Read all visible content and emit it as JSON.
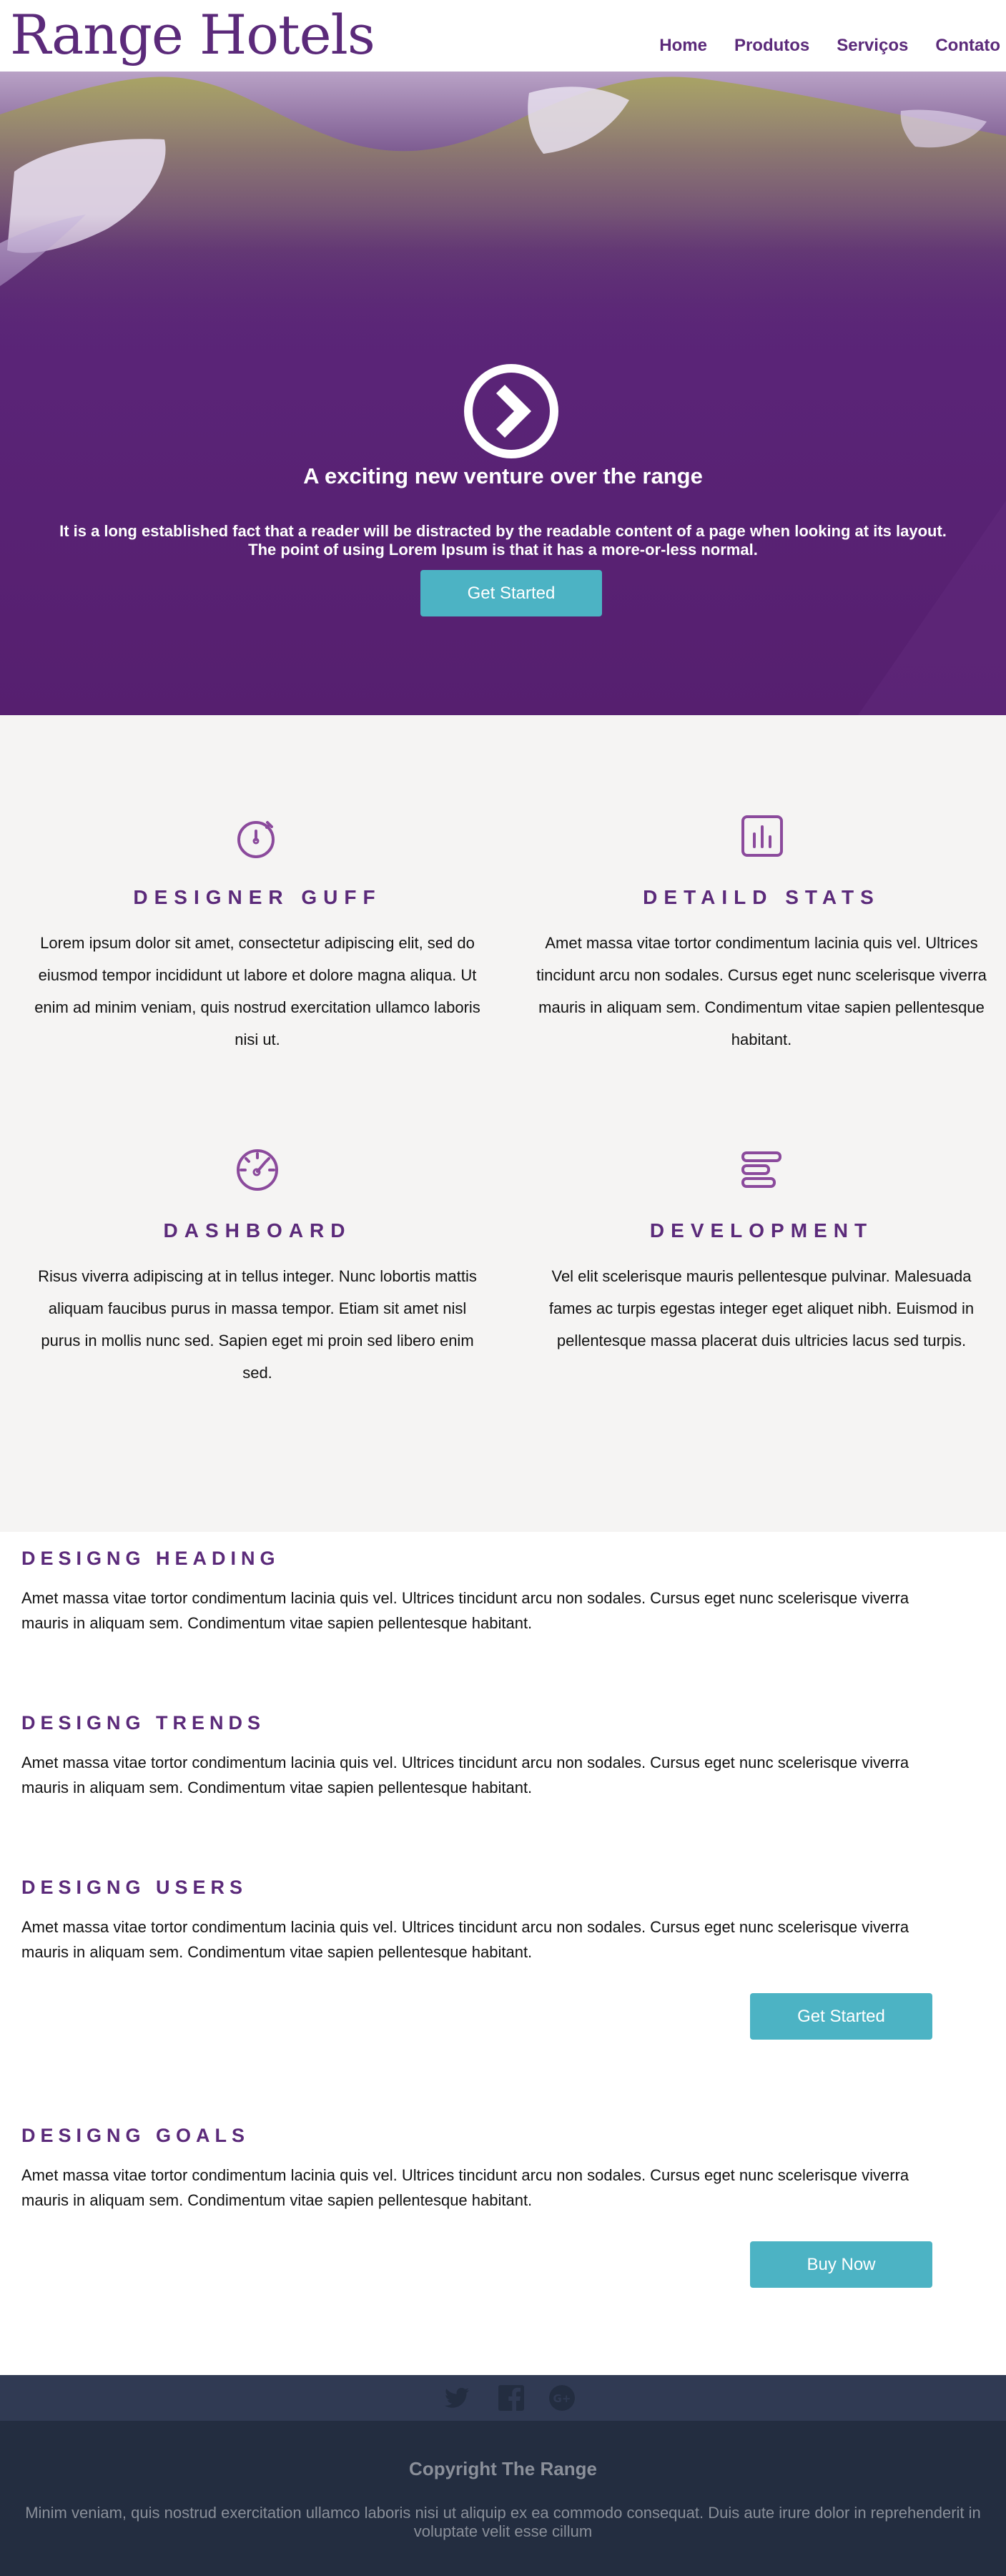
{
  "header": {
    "logo": "Range Hotels",
    "nav": [
      "Home",
      "Produtos",
      "Serviços",
      "Contato"
    ]
  },
  "hero": {
    "title": "A exciting new venture over the range",
    "body_line1": "It is a long established fact that a reader will be distracted by the readable content of a page when looking at its layout.",
    "body_line2": "The point of using Lorem Ipsum is that it has a more-or-less normal.",
    "button": "Get Started",
    "icon": "chevron-right-circle-icon"
  },
  "features": [
    {
      "icon": "stopwatch-icon",
      "title": "DESIGNER GUFF",
      "lines": [
        "Lorem ipsum dolor sit amet, consectetur adipiscing elit, sed do",
        "eiusmod tempor incididunt ut labore et dolore magna aliqua. Ut",
        "enim ad minim veniam, quis nostrud exercitation ullamco laboris",
        "nisi ut."
      ]
    },
    {
      "icon": "bar-chart-icon",
      "title": "DETAILD STATS",
      "lines": [
        "Amet massa vitae tortor condimentum lacinia quis vel. Ultrices",
        "tincidunt arcu non sodales. Cursus eget nunc scelerisque viverra",
        "mauris in aliquam sem. Condimentum vitae sapien pellentesque",
        "habitant."
      ]
    },
    {
      "icon": "speedometer-icon",
      "title": "DASHBOARD",
      "lines": [
        "Risus viverra adipiscing at in tellus integer. Nunc lobortis mattis",
        "aliquam faucibus purus in massa tempor. Etiam sit amet nisl",
        "purus in mollis nunc sed. Sapien eget mi proin sed libero enim",
        "sed."
      ]
    },
    {
      "icon": "menu-bars-icon",
      "title": "DEVELOPMENT",
      "lines": [
        "Vel elit scelerisque mauris pellentesque pulvinar. Malesuada",
        "fames ac turpis egestas integer eget aliquet nibh. Euismod in",
        "pellentesque massa placerat duis ultricies lacus sed turpis."
      ]
    }
  ],
  "blocks": [
    {
      "title": "DESIGNG HEADING",
      "line1": "Amet massa vitae tortor condimentum lacinia quis vel. Ultrices tincidunt arcu non sodales. Cursus eget nunc scelerisque viverra",
      "line2": "mauris in aliquam sem. Condimentum vitae sapien pellentesque habitant."
    },
    {
      "title": "DESIGNG TRENDS",
      "line1": "Amet massa vitae tortor condimentum lacinia quis vel. Ultrices tincidunt arcu non sodales. Cursus eget nunc scelerisque viverra",
      "line2": "mauris in aliquam sem. Condimentum vitae sapien pellentesque habitant."
    },
    {
      "title": "DESIGNG USERS",
      "line1": "Amet massa vitae tortor condimentum lacinia quis vel. Ultrices tincidunt arcu non sodales. Cursus eget nunc scelerisque viverra",
      "line2": "mauris in aliquam sem. Condimentum vitae sapien pellentesque habitant.",
      "button": "Get Started"
    },
    {
      "title": "DESIGNG GOALS",
      "line1": "Amet massa vitae tortor condimentum lacinia quis vel. Ultrices tincidunt arcu non sodales. Cursus eget nunc scelerisque viverra",
      "line2": "mauris in aliquam sem. Condimentum vitae sapien pellentesque habitant.",
      "button": "Buy Now"
    }
  ],
  "social": [
    "twitter-icon",
    "facebook-icon",
    "google-plus-icon"
  ],
  "footer": {
    "copyright": "Copyright The Range",
    "line1": "Minim veniam, quis nostrud exercitation ullamco laboris nisi ut aliquip ex ea commodo consequat. Duis aute irure dolor in reprehenderit in",
    "line2": "voluptate velit esse cillum"
  },
  "colors": {
    "brand": "#5b2a7a",
    "accent": "#4cb3c4",
    "footer": "#232d40",
    "social_bar": "#303a53"
  }
}
